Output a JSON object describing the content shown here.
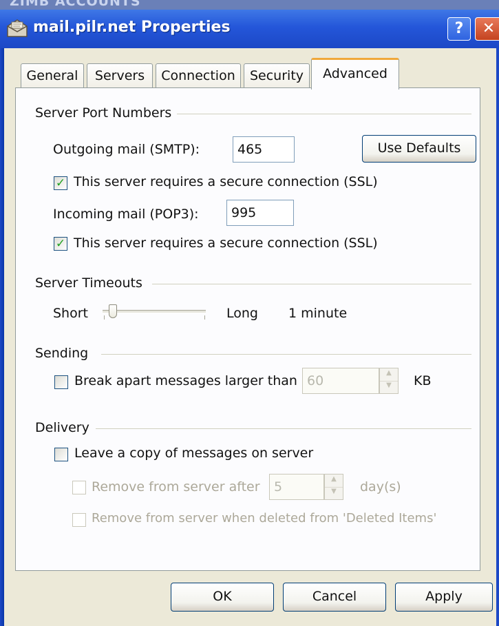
{
  "window": {
    "title": "mail.pilr.net Properties",
    "background_title_fragment": "ZIMB ACCOUNTS",
    "help_label": "?",
    "close_label": "✕"
  },
  "tabs": [
    {
      "label": "General",
      "active": false
    },
    {
      "label": "Servers",
      "active": false
    },
    {
      "label": "Connection",
      "active": false
    },
    {
      "label": "Security",
      "active": false
    },
    {
      "label": "Advanced",
      "active": true
    }
  ],
  "port_numbers": {
    "heading": "Server Port Numbers",
    "outgoing_label": "Outgoing mail (SMTP):",
    "outgoing_value": "465",
    "use_defaults_label": "Use Defaults",
    "outgoing_ssl_label": "This server requires a secure connection (SSL)",
    "outgoing_ssl_checked": true,
    "incoming_label": "Incoming mail (POP3):",
    "incoming_value": "995",
    "incoming_ssl_label": "This server requires a secure connection (SSL)",
    "incoming_ssl_checked": true
  },
  "timeouts": {
    "heading": "Server Timeouts",
    "short_label": "Short",
    "long_label": "Long",
    "value_text": "1 minute",
    "slider_position": 0.1
  },
  "sending": {
    "heading": "Sending",
    "break_apart_label": "Break apart messages larger than",
    "break_apart_checked": false,
    "size_value": "60",
    "unit_label": "KB"
  },
  "delivery": {
    "heading": "Delivery",
    "leave_copy_label": "Leave a copy of messages on server",
    "leave_copy_checked": false,
    "remove_after_label": "Remove from server after",
    "remove_after_value": "5",
    "days_label": "day(s)",
    "remove_deleted_label": "Remove from server when deleted from 'Deleted Items'"
  },
  "buttons": {
    "ok_label": "OK",
    "cancel_label": "Cancel",
    "apply_label": "Apply"
  },
  "colors": {
    "titlebar": "#2456d9",
    "dialog_face": "#ece9d8",
    "active_tab_accent": "#f0a83a",
    "checkmark": "#21a121",
    "close_button": "#c4431f"
  },
  "icons": {
    "title": "mail-account-icon",
    "help": "help-icon",
    "close": "close-icon",
    "checkmark": "check-icon"
  }
}
